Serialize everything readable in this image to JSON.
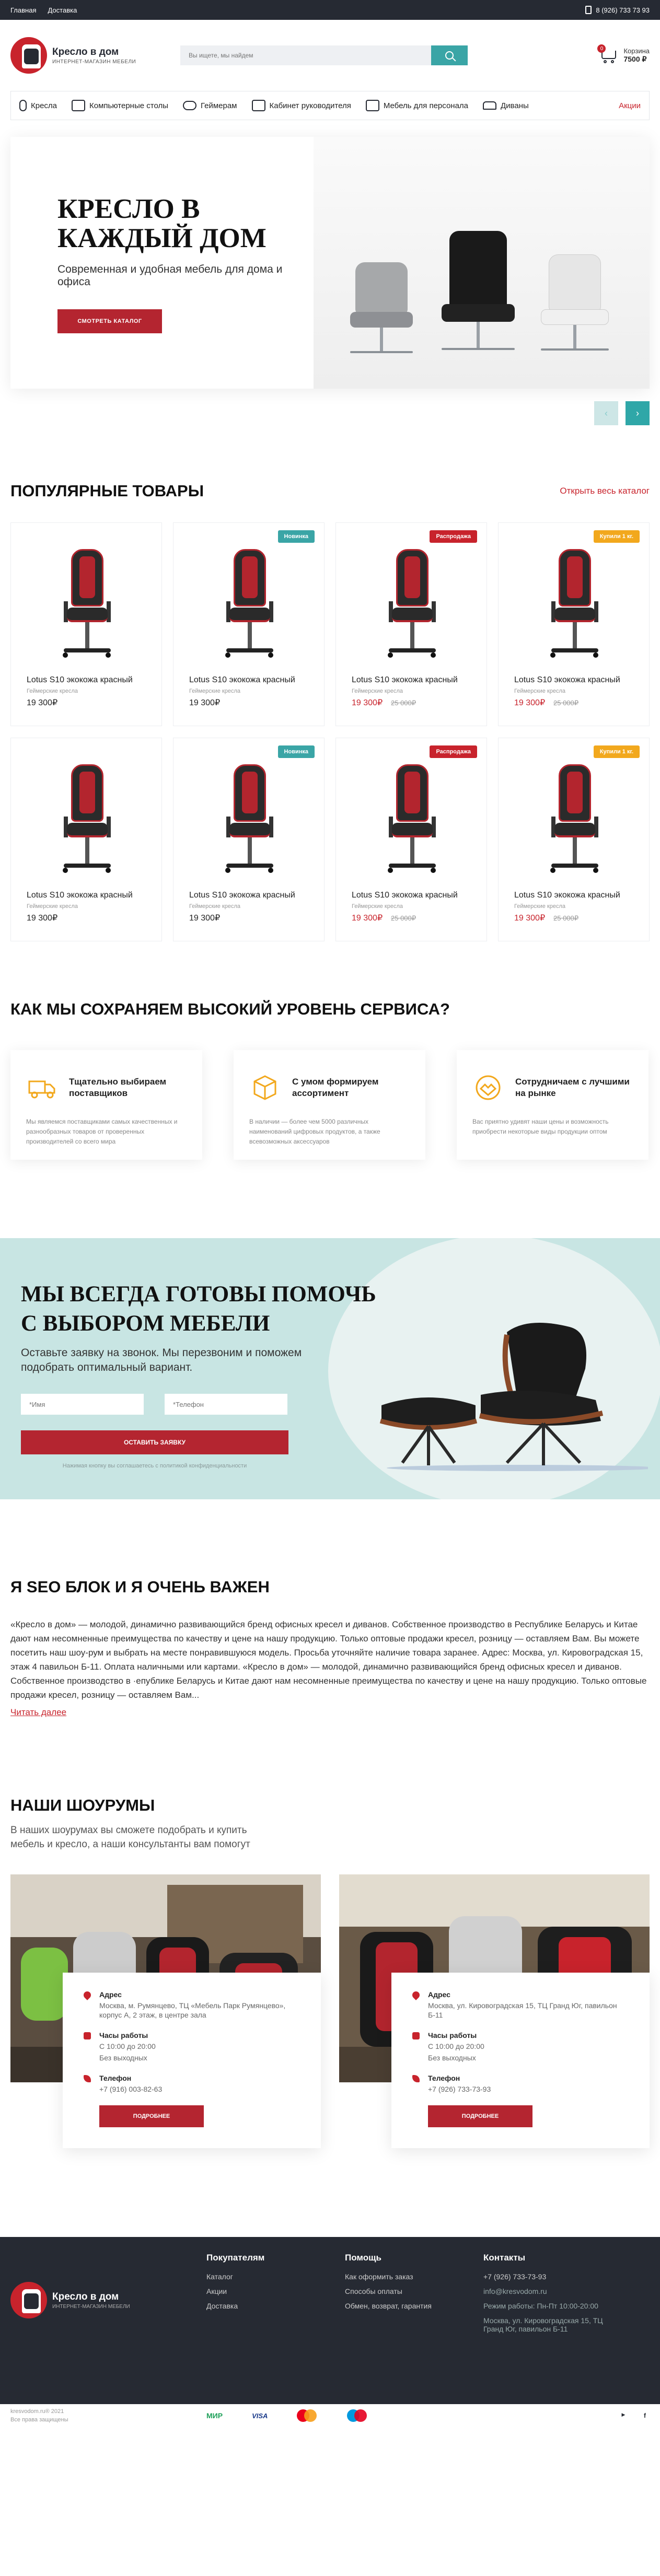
{
  "topbar": {
    "nav": [
      "Главная",
      "Доставка"
    ],
    "phone": "8 (926) 733 73 93"
  },
  "header": {
    "logo_title": "Кресло в дом",
    "logo_subtitle": "ИНТЕРНЕТ-МАГАЗИН МЕБЕЛИ",
    "search_placeholder": "Вы ищете, мы найдем",
    "cart_count": "0",
    "cart_label": "Корзина",
    "cart_sum": "7500 ₽"
  },
  "catnav": [
    "Кресла",
    "Компьютерные столы",
    "Геймерам",
    "Кабинет руководителя",
    "Мебель для персонала",
    "Диваны"
  ],
  "catnav_promo": "Акции",
  "hero": {
    "title_line1": "КРЕСЛО В",
    "title_line2": "КАЖДЫЙ ДОМ",
    "subtitle": "Современная и удобная мебель для дома и офиса",
    "button": "СМОТРЕТЬ КАТАЛОГ"
  },
  "popular": {
    "title": "ПОПУЛЯРНЫЕ ТОВАРЫ",
    "link": "Открыть весь каталог",
    "products": [
      {
        "tag": "",
        "tag_type": "",
        "name": "Lotus S10 экокожа красный",
        "type": "Геймерские кресла",
        "price": "19 300₽",
        "old": "",
        "red": false
      },
      {
        "tag": "Новинка",
        "tag_type": "new",
        "name": "Lotus S10 экокожа красный",
        "type": "Геймерские кресла",
        "price": "19 300₽",
        "old": "",
        "red": false
      },
      {
        "tag": "Распродажа",
        "tag_type": "sale",
        "name": "Lotus S10 экокожа красный",
        "type": "Геймерские кресла",
        "price": "19 300₽",
        "old": "25 000₽",
        "red": true
      },
      {
        "tag": "Купили 1 кг.",
        "tag_type": "hit",
        "name": "Lotus S10 экокожа красный",
        "type": "Геймерские кресла",
        "price": "19 300₽",
        "old": "25 000₽",
        "red": true
      },
      {
        "tag": "",
        "tag_type": "",
        "name": "Lotus S10 экокожа красный",
        "type": "Геймерские кресла",
        "price": "19 300₽",
        "old": "",
        "red": false
      },
      {
        "tag": "Новинка",
        "tag_type": "new",
        "name": "Lotus S10 экокожа красный",
        "type": "Геймерские кресла",
        "price": "19 300₽",
        "old": "",
        "red": false
      },
      {
        "tag": "Распродажа",
        "tag_type": "sale",
        "name": "Lotus S10 экокожа красный",
        "type": "Геймерские кресла",
        "price": "19 300₽",
        "old": "25 000₽",
        "red": true
      },
      {
        "tag": "Купили 1 кг.",
        "tag_type": "hit",
        "name": "Lotus S10 экокожа красный",
        "type": "Геймерские кресла",
        "price": "19 300₽",
        "old": "25 000₽",
        "red": true
      }
    ]
  },
  "service": {
    "title": "КАК МЫ СОХРАНЯЕМ ВЫСОКИЙ УРОВЕНЬ СЕРВИСА?",
    "items": [
      {
        "title": "Тщательно выбираем поставщиков",
        "text": "Мы являемся поставщиками самых качественных и разнообразных товаров от проверенных производителей со всего мира"
      },
      {
        "title": "С умом формируем ассортимент",
        "text": "В наличии — более чем 5000 различных наименований цифровых продуктов, а также всевозможных аксессуаров"
      },
      {
        "title": "Сотрудничаем с лучшими на рынке",
        "text": "Вас приятно удивят наши цены и возможность приобрести некоторые виды продукции оптом"
      }
    ]
  },
  "help": {
    "title_line1": "МЫ ВСЕГДА ГОТОВЫ ПОМОЧЬ",
    "title_line2": "С ВЫБОРОМ МЕБЕЛИ",
    "subtitle": "Оставьте заявку на звонок. Мы перезвоним и поможем подобрать оптимальный вариант.",
    "name_placeholder": "*Имя",
    "phone_placeholder": "*Телефон",
    "button": "ОСТАВИТЬ ЗАЯВКУ",
    "note": "Нажимая кнопку вы соглашаетесь с политикой конфиденциальности"
  },
  "seo": {
    "title": "Я SEO БЛОК И Я ОЧЕНЬ ВАЖЕН",
    "text": "«Кресло в дом» — молодой, динамично развивающийся бренд офисных кресел и диванов. Собственное производство в Республике Беларусь и Китае дают нам несомненные преимущества по качеству и цене на нашу продукцию. Только оптовые продажи кресел, розницу — оставляем Вам. Вы можете посетить наш шоу-рум и выбрать на месте понравившуюся модель. Просьба уточняйте наличие товара заранее. Адрес: Москва, ул. Кировоградская 15, этаж 4 павильон Б-11. Оплата наличными или картами. «Кресло в дом» — молодой, динамично развивающийся бренд офисных кресел и диванов. Собственное производство в ·епублике Беларусь и Китае дают нам несомненные преимущества по качеству и цене на нашу продукцию. Только оптовые продажи кресел, розницу — оставляем Вам...",
    "more": "Читать далее"
  },
  "showrooms": {
    "title": "НАШИ ШОУРУМЫ",
    "subtitle": "В наших шоурумах вы сможете подобрать и купить мебель и кресло, а наши консультанты вам помогут",
    "items": [
      {
        "addr_label": "Адрес",
        "addr": "Москва, м. Румянцево, ТЦ «Мебель Парк Румянцево», корпус А, 2 этаж, в центре зала",
        "hours_label": "Часы работы",
        "hours1": "С 10:00 до 20:00",
        "hours2": "Без выходных",
        "phone_label": "Телефон",
        "phone": "+7 (916) 003-82-63",
        "button": "ПОДРОБНЕЕ"
      },
      {
        "addr_label": "Адрес",
        "addr": "Москва, ул. Кировоградская 15, ТЦ Гранд Юг, павильон Б-11",
        "hours_label": "Часы работы",
        "hours1": "С 10:00 до 20:00",
        "hours2": "Без выходных",
        "phone_label": "Телефон",
        "phone": "+7 (926) 733-73-93",
        "button": "ПОДРОБНЕЕ"
      }
    ]
  },
  "footer": {
    "col1_title": "Покупателям",
    "col1": [
      "Каталог",
      "Акции",
      "Доставка"
    ],
    "col2_title": "Помощь",
    "col2": [
      "Как оформить заказ",
      "Способы оплаты",
      "Обмен, возврат, гарантия"
    ],
    "col3_title": "Контакты",
    "phone": "+7 (926) 733-73-93",
    "email": "info@kresvodom.ru",
    "mode": "Режим работы: Пн-Пт 10:00-20:00",
    "address": "Москва, ул. Кировоградская 15, ТЦ Гранд Юг, павильон Б-11",
    "copyright1": "kresvodom.ru® 2021",
    "copyright2": "Все права защищены",
    "pay_mir": "МИР",
    "pay_visa": "VISA"
  },
  "colors": {
    "accent_red": "#c8232c",
    "teal": "#3aa5a6",
    "dark": "#262a33"
  }
}
